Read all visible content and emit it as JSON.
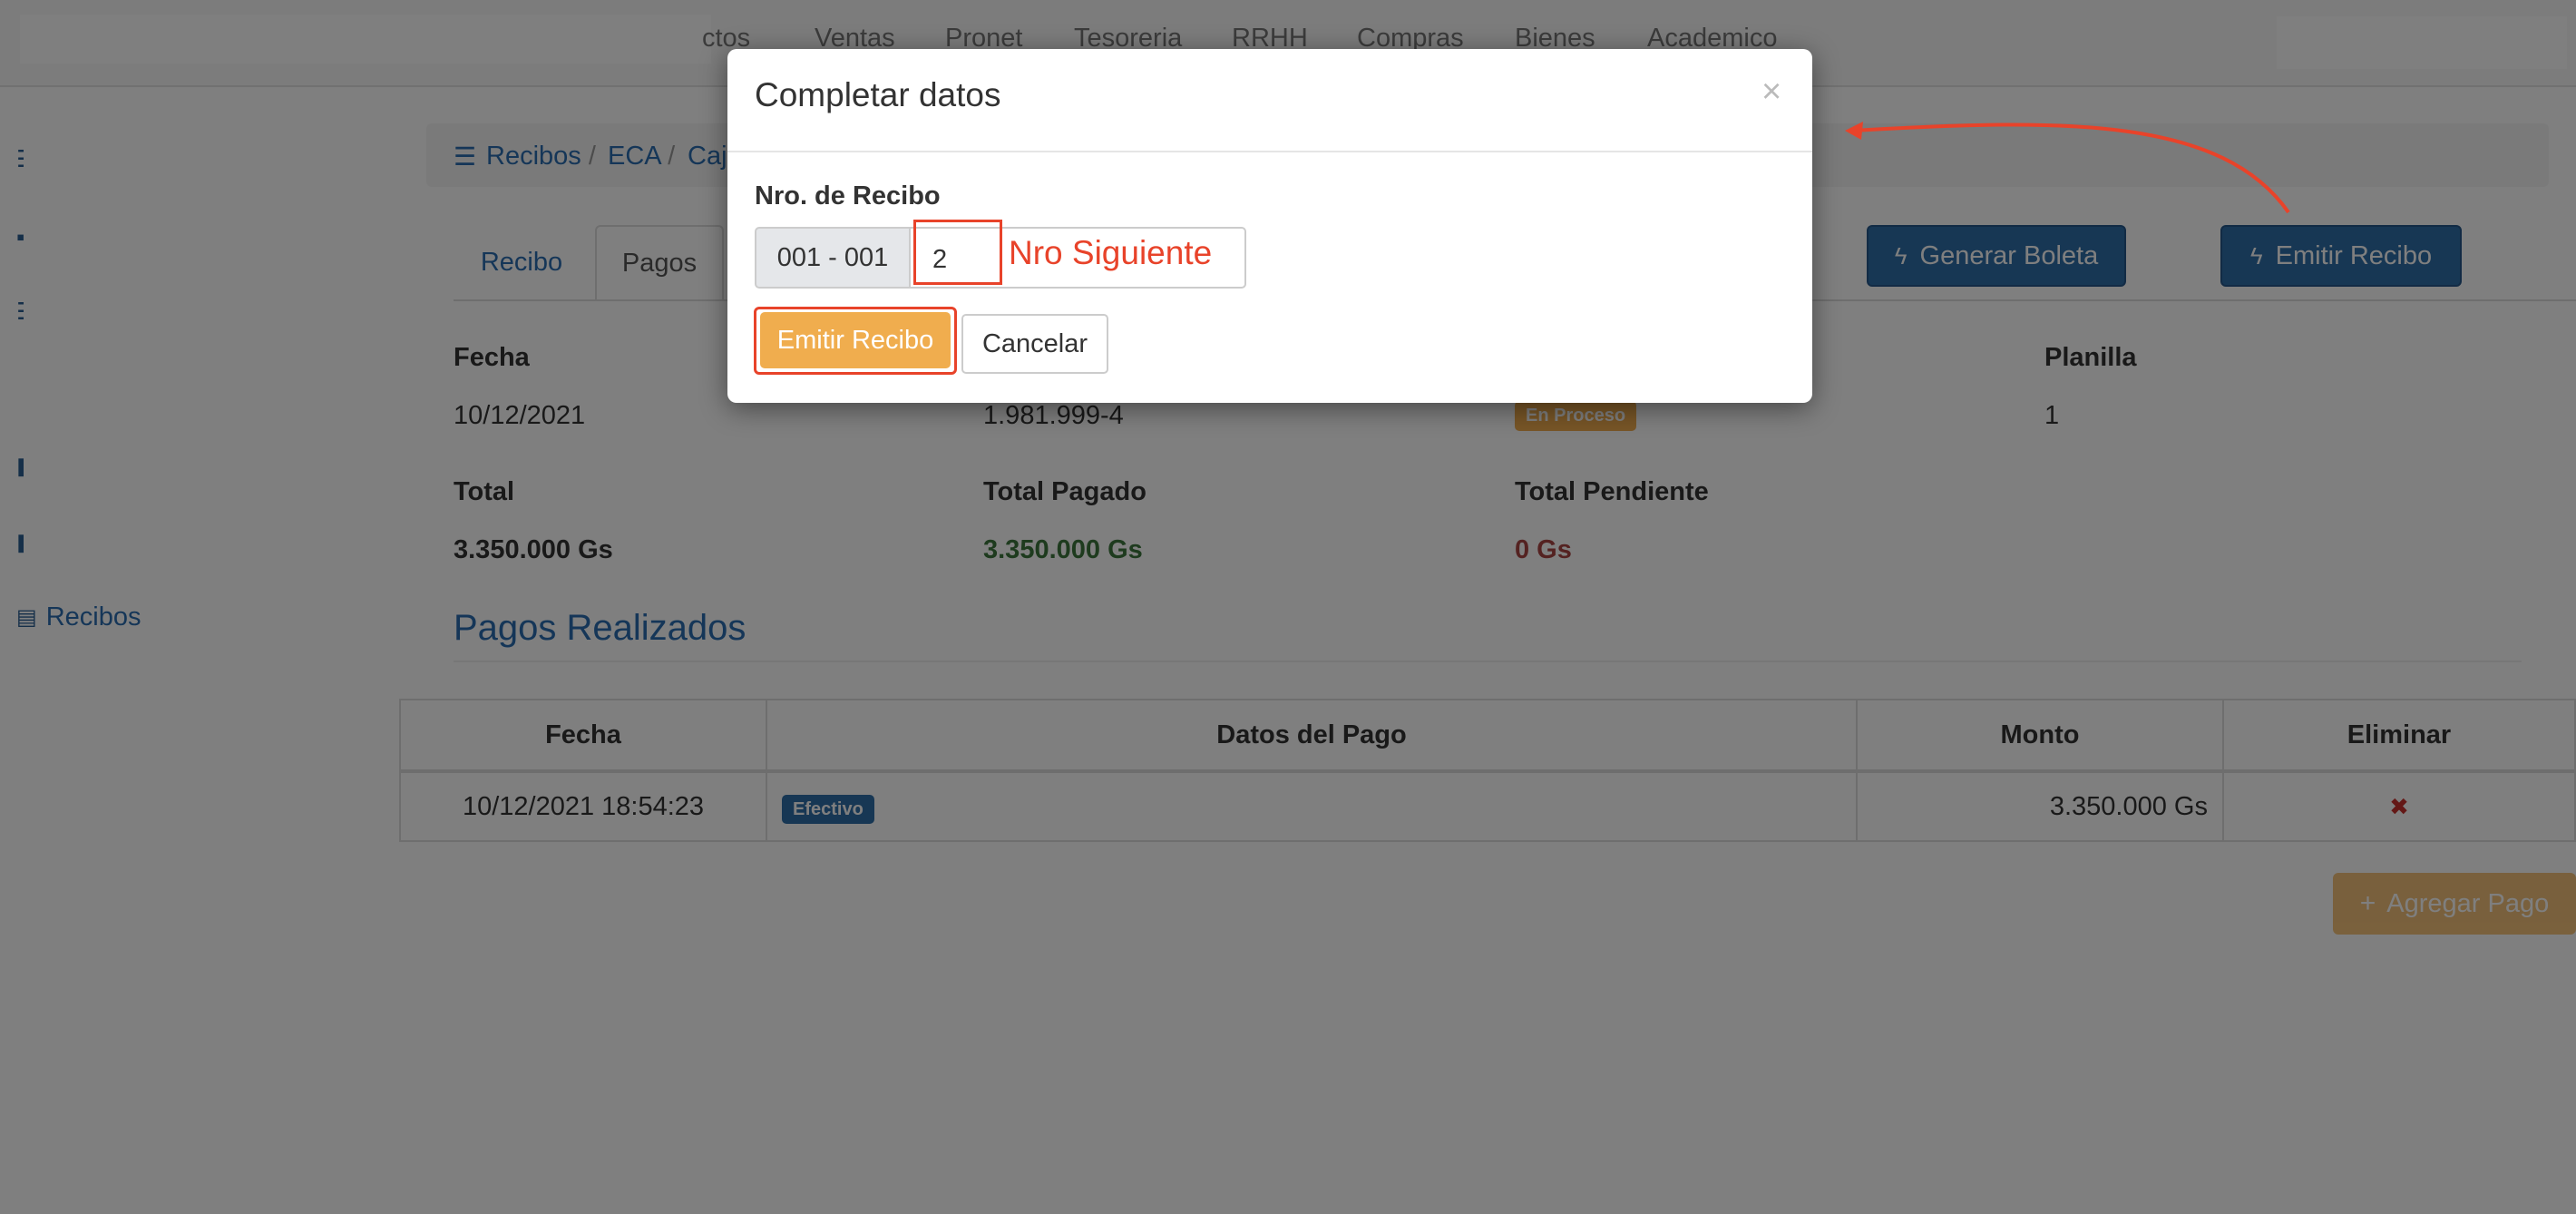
{
  "navbar": {
    "items": [
      "ctos",
      "Ventas",
      "Pronet",
      "Tesoreria",
      "RRHH",
      "Compras",
      "Bienes",
      "Academico"
    ]
  },
  "sidebar": {
    "recibos_label": "Recibos"
  },
  "breadcrumb": {
    "items": [
      "Recibos",
      "ECA",
      "Caj"
    ],
    "separator": "/"
  },
  "tabs": [
    "Recibo",
    "Pagos"
  ],
  "actions": {
    "generar_boleta": "Generar Boleta",
    "emitir_recibo": "Emitir Recibo"
  },
  "info": {
    "fecha_label": "Fecha",
    "fecha_value": "10/12/2021",
    "ruc_value": "1.981.999-4",
    "estado_badge": "En Proceso",
    "planilla_label": "Planilla",
    "planilla_value": "1",
    "total_label": "Total",
    "total_value": "3.350.000 Gs",
    "total_pagado_label": "Total Pagado",
    "total_pagado_value": "3.350.000 Gs",
    "total_pendiente_label": "Total Pendiente",
    "total_pendiente_value": "0 Gs"
  },
  "pagos": {
    "title": "Pagos Realizados",
    "headers": [
      "Fecha",
      "Datos del Pago",
      "Monto",
      "Eliminar"
    ],
    "rows": [
      {
        "fecha": "10/12/2021 18:54:23",
        "tipo": "Efectivo",
        "monto": "3.350.000 Gs",
        "eliminar_icon": "✖"
      }
    ],
    "agregar_label": "Agregar Pago"
  },
  "modal": {
    "title": "Completar datos",
    "close": "×",
    "field_label": "Nro. de Recibo",
    "prefix": "001 - 001",
    "number_value": "2",
    "hint": "Nro Siguiente",
    "emit_label": "Emitir Recibo",
    "cancel_label": "Cancelar"
  },
  "colors": {
    "primary": "#2f6ea8",
    "warning": "#f0ad4e",
    "annotation": "#e8432a",
    "success_text": "#3c763d",
    "danger_text": "#a94442"
  }
}
